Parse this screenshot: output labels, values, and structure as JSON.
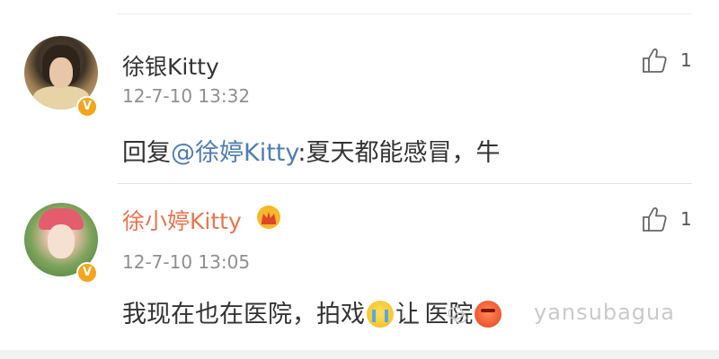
{
  "comments": [
    {
      "username": "徐银Kitty",
      "timestamp": "12-7-10 13:32",
      "body": {
        "prefix": "回复",
        "mention": "@徐婷Kitty",
        "text": ":夏天都能感冒，牛"
      },
      "likes": "1",
      "verified_badge": "V"
    },
    {
      "username": "徐小婷Kitty",
      "timestamp": "12-7-10 13:05",
      "body": {
        "text_before_emoji": "我现在也在医院，拍戏",
        "text_between": "让",
        "text_after": "医院"
      },
      "likes": "1",
      "verified_badge": "V"
    }
  ],
  "watermark": "yansubagua",
  "colors": {
    "username_default": "#333333",
    "username_vip": "#eb7350",
    "mention": "#507daf",
    "timestamp": "#8f8f8f",
    "verified_badge": "#f3a61a"
  },
  "icons": [
    "thumbs-up-icon",
    "verified-badge-icon",
    "crown-vip-icon",
    "crying-emoji-icon",
    "angry-emoji-icon"
  ]
}
